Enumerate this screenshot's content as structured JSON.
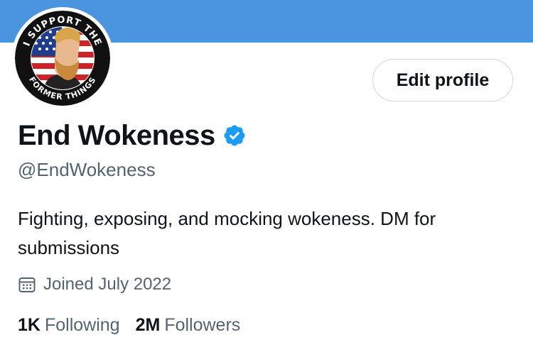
{
  "profile": {
    "display_name": "End Wokeness",
    "handle": "@EndWokeness",
    "bio": "Fighting, exposing, and mocking wokeness. DM for submissions",
    "joined": "Joined July 2022",
    "verified_icon": "verified-badge-icon",
    "avatar_text_top": "I SUPPORT THE",
    "avatar_text_bottom": "FORMER THINGS"
  },
  "actions": {
    "edit_profile_label": "Edit profile"
  },
  "stats": {
    "following_count": "1K",
    "following_label": "Following",
    "followers_count": "2M",
    "followers_label": "Followers"
  },
  "colors": {
    "banner": "#4a94e0",
    "verified": "#1d9bf0",
    "secondary_text": "#536471",
    "primary_text": "#0f1419"
  }
}
